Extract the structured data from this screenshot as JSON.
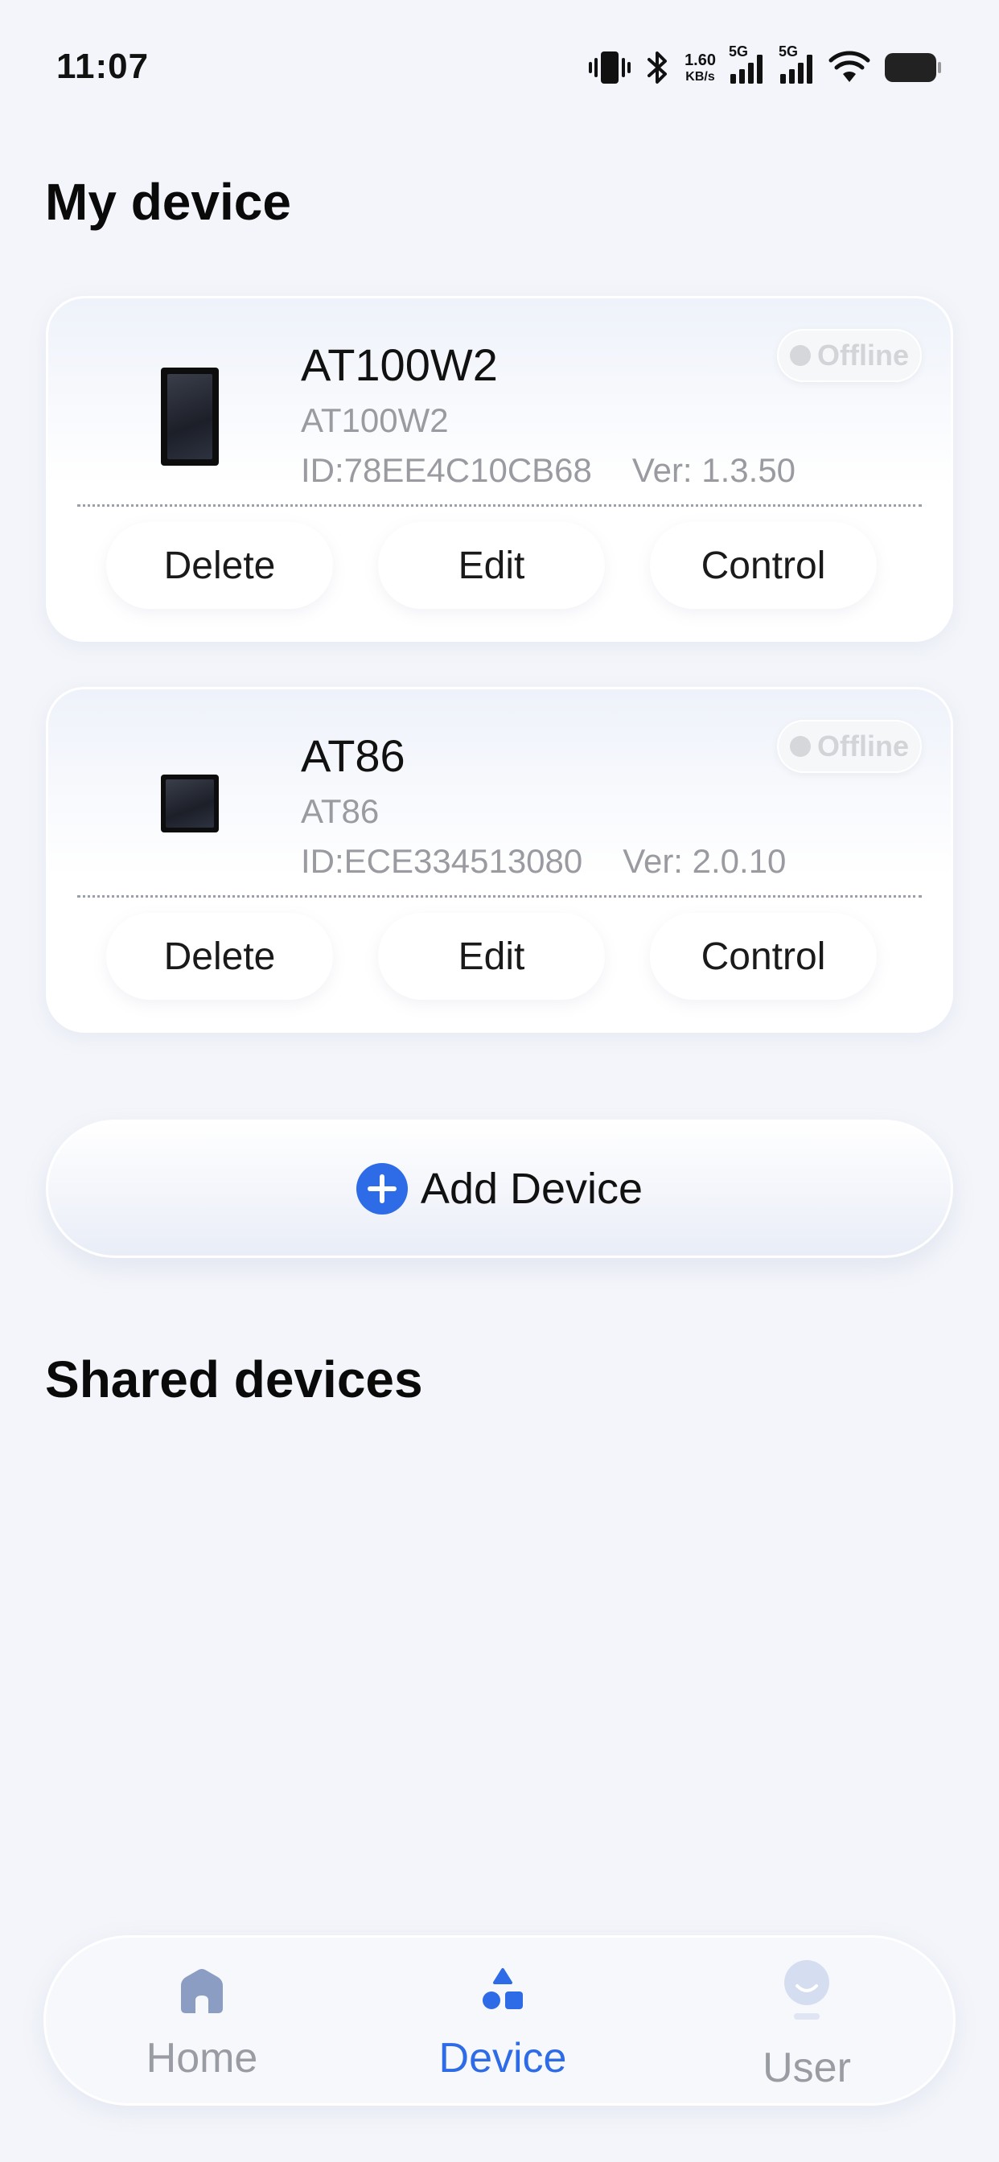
{
  "status_bar": {
    "time": "11:07",
    "net_speed_value": "1.60",
    "net_speed_unit": "KB/s",
    "sim1_tag": "5G",
    "sim2_tag": "5G",
    "icons": [
      "vibrate-icon",
      "bluetooth-icon",
      "signal-icon",
      "signal-icon",
      "wifi-icon",
      "battery-icon"
    ]
  },
  "my_device": {
    "title": "My device",
    "devices": [
      {
        "name": "AT100W2",
        "model": "AT100W2",
        "id": "ID:78EE4C10CB68",
        "version": "Ver: 1.3.50",
        "status": "Offline",
        "actions": {
          "delete": "Delete",
          "edit": "Edit",
          "control": "Control"
        }
      },
      {
        "name": "AT86",
        "model": "AT86",
        "id": "ID:ECE334513080",
        "version": "Ver: 2.0.10",
        "status": "Offline",
        "actions": {
          "delete": "Delete",
          "edit": "Edit",
          "control": "Control"
        }
      }
    ]
  },
  "add_device": {
    "label": "Add Device"
  },
  "shared_devices": {
    "title": "Shared devices"
  },
  "bottom_nav": {
    "active": "Device",
    "items": [
      {
        "label": "Home",
        "icon": "home-icon"
      },
      {
        "label": "Device",
        "icon": "device-icon"
      },
      {
        "label": "User",
        "icon": "user-icon"
      }
    ]
  },
  "colors": {
    "accent": "#2e6be6",
    "background": "#f3f5fa",
    "muted": "#9a9ba1"
  }
}
